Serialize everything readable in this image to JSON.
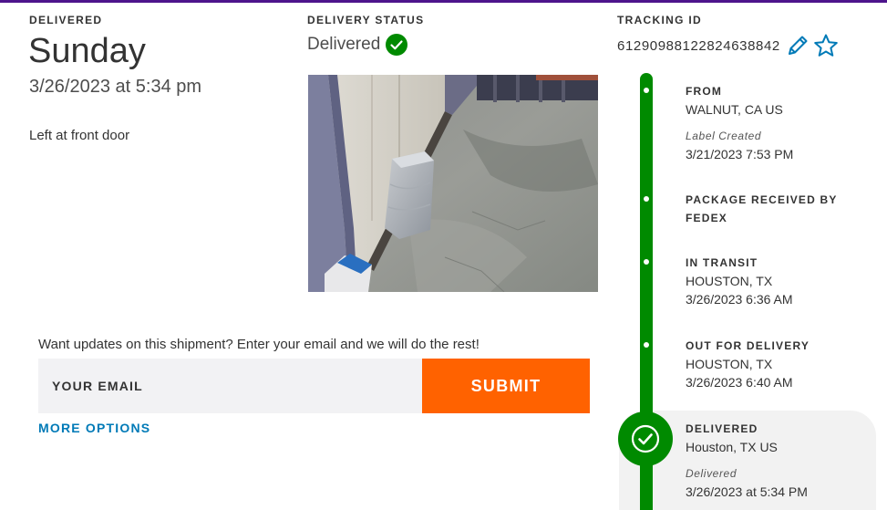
{
  "summary": {
    "delivered_label": "DELIVERED",
    "day": "Sunday",
    "datetime": "3/26/2023 at 5:34 pm",
    "location_note": "Left at front door"
  },
  "status": {
    "label": "DELIVERY STATUS",
    "value": "Delivered",
    "icon": "check-circle-icon",
    "color": "#008a00"
  },
  "tracking": {
    "label": "TRACKING ID",
    "id": "612909881228246388­42",
    "edit_icon": "pencil-icon",
    "favorite_icon": "star-icon",
    "icon_color": "#007ab7"
  },
  "updates": {
    "prompt": "Want updates on this shipment? Enter your email and we will do the rest!",
    "email_placeholder": "YOUR EMAIL",
    "email_value": "",
    "submit_label": "SUBMIT",
    "more_options_label": "MORE OPTIONS",
    "submit_color": "#ff6200"
  },
  "timeline": {
    "color": "#008a00",
    "steps": [
      {
        "title": "FROM",
        "line1": "WALNUT, CA US",
        "italic": "Label Created",
        "line2": "3/21/2023 7:53 PM"
      },
      {
        "title": "PACKAGE RECEIVED BY",
        "title2": "FEDEX"
      },
      {
        "title": "IN TRANSIT",
        "line1": "HOUSTON, TX",
        "line2": "3/26/2023 6:36 AM"
      },
      {
        "title": "OUT FOR DELIVERY",
        "line1": "HOUSTON, TX",
        "line2": "3/26/2023 6:40 AM"
      },
      {
        "title": "DELIVERED",
        "line1": "Houston, TX US",
        "italic": "Delivered",
        "line2": "3/26/2023 at 5:34 PM"
      }
    ]
  }
}
